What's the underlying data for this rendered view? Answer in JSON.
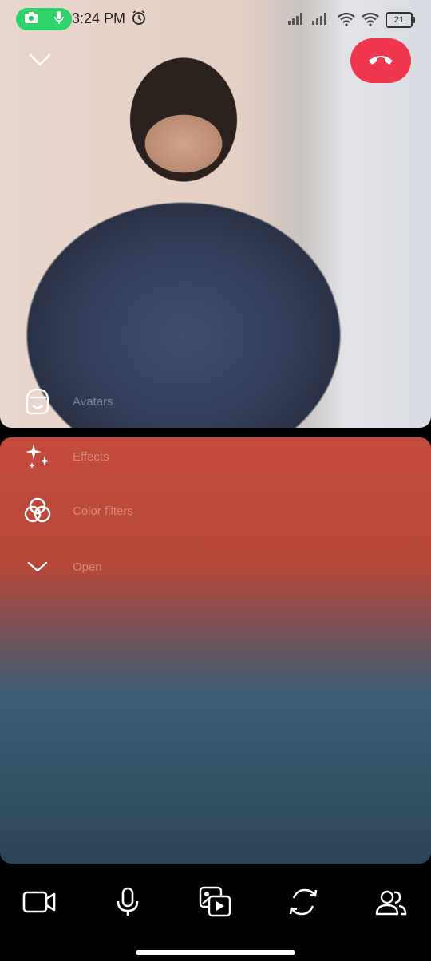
{
  "status": {
    "time": "3:24 PM",
    "battery": "21",
    "icons": [
      "camera-icon",
      "mic-icon",
      "alarm-icon",
      "signal-icon",
      "signal-icon",
      "wifi-icon",
      "wifi-icon",
      "battery-icon"
    ]
  },
  "call": {
    "end_icon": "hangup-icon",
    "collapse_icon": "chevron-down-icon"
  },
  "side_menu": {
    "avatars": "Avatars",
    "effects": "Effects",
    "color_filters": "Color filters",
    "open": "Open"
  },
  "bottom_bar": {
    "buttons": [
      "video-camera-icon",
      "microphone-icon",
      "share-media-icon",
      "flip-camera-icon",
      "participants-icon"
    ]
  },
  "colors": {
    "end_call": "#f0374d",
    "status_pill": "#2fd26b"
  }
}
